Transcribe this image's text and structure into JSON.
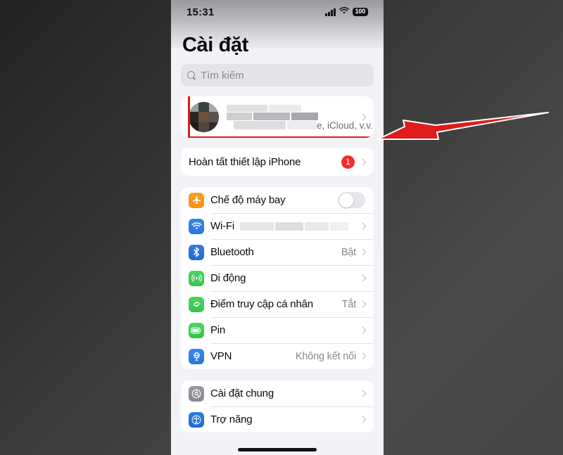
{
  "status_bar": {
    "time": "15:31",
    "signal_icon": "cellular-signal-icon",
    "wifi_icon": "wifi-status-icon",
    "battery_level": "100"
  },
  "header": {
    "title": "Cài đặt"
  },
  "search": {
    "icon": "search-icon",
    "placeholder": "Tìm kiếm",
    "value": ""
  },
  "apple_id": {
    "name_redacted": true,
    "subtitle": "e, iCloud, v.v.",
    "avatar": "user-avatar",
    "chevron": "chevron-right-icon",
    "highlighted": true,
    "highlight_color": "#e01b1b"
  },
  "annotation": {
    "arrow_color": "#e01b1b",
    "arrow_direction": "left",
    "points_to": "apple-id-row"
  },
  "setup_group": {
    "rows": [
      {
        "label": "Hoàn tất thiết lập iPhone",
        "badge": "1",
        "badge_color": "#fb2b2b"
      }
    ]
  },
  "connectivity_group": {
    "rows": [
      {
        "label": "Chế độ máy bay",
        "icon": "airplane-icon",
        "icon_class": "ic-airplane",
        "control": "toggle",
        "toggle_on": false,
        "value": ""
      },
      {
        "label": "Wi-Fi",
        "icon": "wifi-icon",
        "icon_class": "ic-wifi",
        "control": "chevron",
        "value": "",
        "value_redacted": true
      },
      {
        "label": "Bluetooth",
        "icon": "bluetooth-icon",
        "icon_class": "ic-bt",
        "control": "chevron",
        "value": "Bật"
      },
      {
        "label": "Di động",
        "icon": "cellular-icon",
        "icon_class": "ic-cell",
        "control": "chevron",
        "value": ""
      },
      {
        "label": "Điểm truy cập cá nhân",
        "icon": "hotspot-icon",
        "icon_class": "ic-hotspot",
        "control": "chevron",
        "value": "Tắt"
      },
      {
        "label": "Pin",
        "icon": "battery-icon",
        "icon_class": "ic-batt",
        "control": "chevron",
        "value": ""
      },
      {
        "label": "VPN",
        "icon": "vpn-icon",
        "icon_class": "ic-vpn",
        "control": "chevron",
        "value": "Không kết nối"
      }
    ]
  },
  "general_group": {
    "rows": [
      {
        "label": "Cài đặt chung",
        "icon": "gear-icon",
        "icon_class": "ic-gear",
        "control": "chevron",
        "value": ""
      },
      {
        "label": "Trợ năng",
        "icon": "accessibility-icon",
        "icon_class": "ic-access",
        "control": "chevron",
        "value": ""
      }
    ]
  }
}
